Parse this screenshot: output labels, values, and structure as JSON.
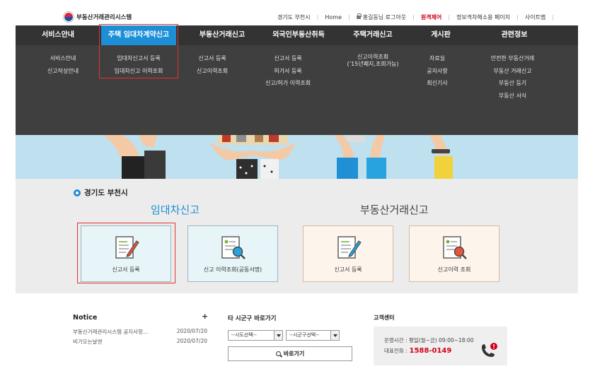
{
  "topbar": {
    "logo_text": "부동산거래관리시스템",
    "links": [
      {
        "label": "경기도 부천시",
        "style": "normal"
      },
      {
        "label": "Home",
        "style": "normal"
      },
      {
        "label": "홍길동님 로그아웃",
        "style": "lock"
      },
      {
        "label": "원격제어",
        "style": "red"
      },
      {
        "label": "정보격차해소용 페이지",
        "style": "normal"
      },
      {
        "label": "사이트맵",
        "style": "normal"
      }
    ]
  },
  "nav": {
    "tabs": [
      "서비스안내",
      "주택 임대차계약신고",
      "부동산거래신고",
      "외국인부동산취득",
      "주택거래신고",
      "게시판",
      "관련정보"
    ],
    "active_tab": 1,
    "columns": [
      [
        "서비스안내",
        "신고작성안내"
      ],
      [
        "임대차신고서 등록",
        "임대차신고 이력조회"
      ],
      [
        "신고서 등록",
        "신고이력조회"
      ],
      [
        "신고서 등록",
        "허가서 등록",
        "신고/허가 이력조회"
      ],
      [
        "신고이력조회",
        "(’15년폐지,조회가능)"
      ],
      [
        "자료실",
        "공지사항",
        "최신기사"
      ],
      [
        "안전한 부동산거래",
        "부동산 거래신고",
        "부동산 등기",
        "부동산 서식"
      ]
    ]
  },
  "panel": {
    "location": "경기도 부천시",
    "lease_title": "임대차신고",
    "trade_title": "부동산거래신고",
    "cards": [
      {
        "label": "신고서 등록",
        "icon": "edit-document-icon"
      },
      {
        "label": "신고 이력조회(공동서명)",
        "icon": "search-document-icon"
      },
      {
        "label": "신고서 등록",
        "icon": "edit-document-icon"
      },
      {
        "label": "신고이력 조회",
        "icon": "search-document-icon"
      }
    ]
  },
  "notice": {
    "title": "Notice",
    "more": "+",
    "items": [
      {
        "title": "부동산거래관리시스템 공지사항…",
        "date": "2020/07/20"
      },
      {
        "title": "비가오는날엔",
        "date": "2020/07/20"
      }
    ]
  },
  "goto": {
    "title": "타 시군구 바로가기",
    "sido_select": "--시도선택--",
    "sigungu_select": "--시군구선택--",
    "button": "바로가기"
  },
  "cs": {
    "title": "고객센터",
    "hours": "운영시간 : 평일(월~금) 09:00~18:00",
    "phone_label": "대표전화 :",
    "phone": "1588-0149"
  },
  "colors": {
    "nav_bg": "#3f3f3f",
    "active_tab": "#1d8fd6",
    "highlight_box": "#e03131",
    "hero_bg": "#bfe0ee",
    "accent_red": "#d0021b"
  }
}
